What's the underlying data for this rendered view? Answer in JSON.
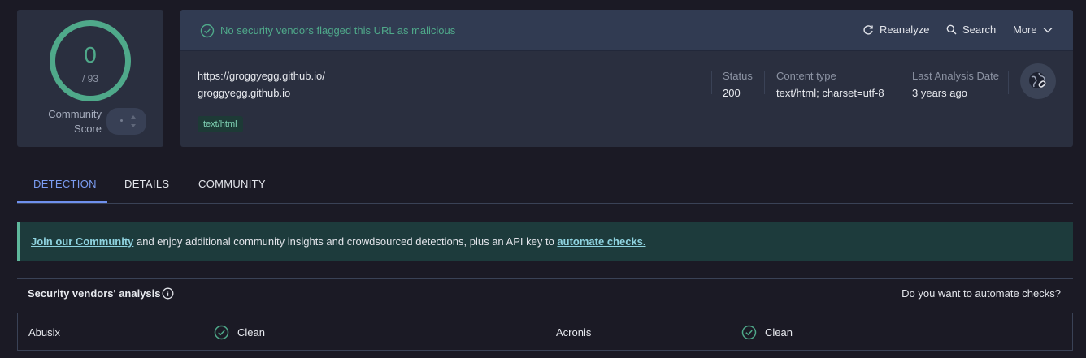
{
  "score": {
    "detections": "0",
    "total": "/ 93",
    "community_label": "Community Score",
    "ring_color": "#4fa98a"
  },
  "header": {
    "status_message": "No security vendors flagged this URL as malicious",
    "status_icon": "check-circle-icon",
    "actions": {
      "reanalyze": "Reanalyze",
      "search": "Search",
      "more": "More"
    }
  },
  "url": {
    "full": "https://groggyegg.github.io/",
    "host": "groggyegg.github.io",
    "tag": "text/html"
  },
  "meta": {
    "status_label": "Status",
    "status_value": "200",
    "content_type_label": "Content type",
    "content_type_value": "text/html; charset=utf-8",
    "last_analysis_label": "Last Analysis Date",
    "last_analysis_value": "3 years ago",
    "globe_icon": "globe-link-icon"
  },
  "tabs": {
    "detection": "DETECTION",
    "details": "DETAILS",
    "community": "COMMUNITY",
    "active": "DETECTION"
  },
  "banner": {
    "link1": "Join our Community",
    "middle": " and enjoy additional community insights and crowdsourced detections, plus an API key to ",
    "link2": "automate checks."
  },
  "analysis": {
    "title": "Security vendors' analysis",
    "automate_prompt": "Do you want to automate checks?",
    "vendors": [
      {
        "name": "Abusix",
        "result": "Clean"
      },
      {
        "name": "Acronis",
        "result": "Clean"
      }
    ]
  },
  "colors": {
    "clean": "#4fa98a",
    "accent": "#7b9cf1",
    "background": "#1b1a25"
  }
}
